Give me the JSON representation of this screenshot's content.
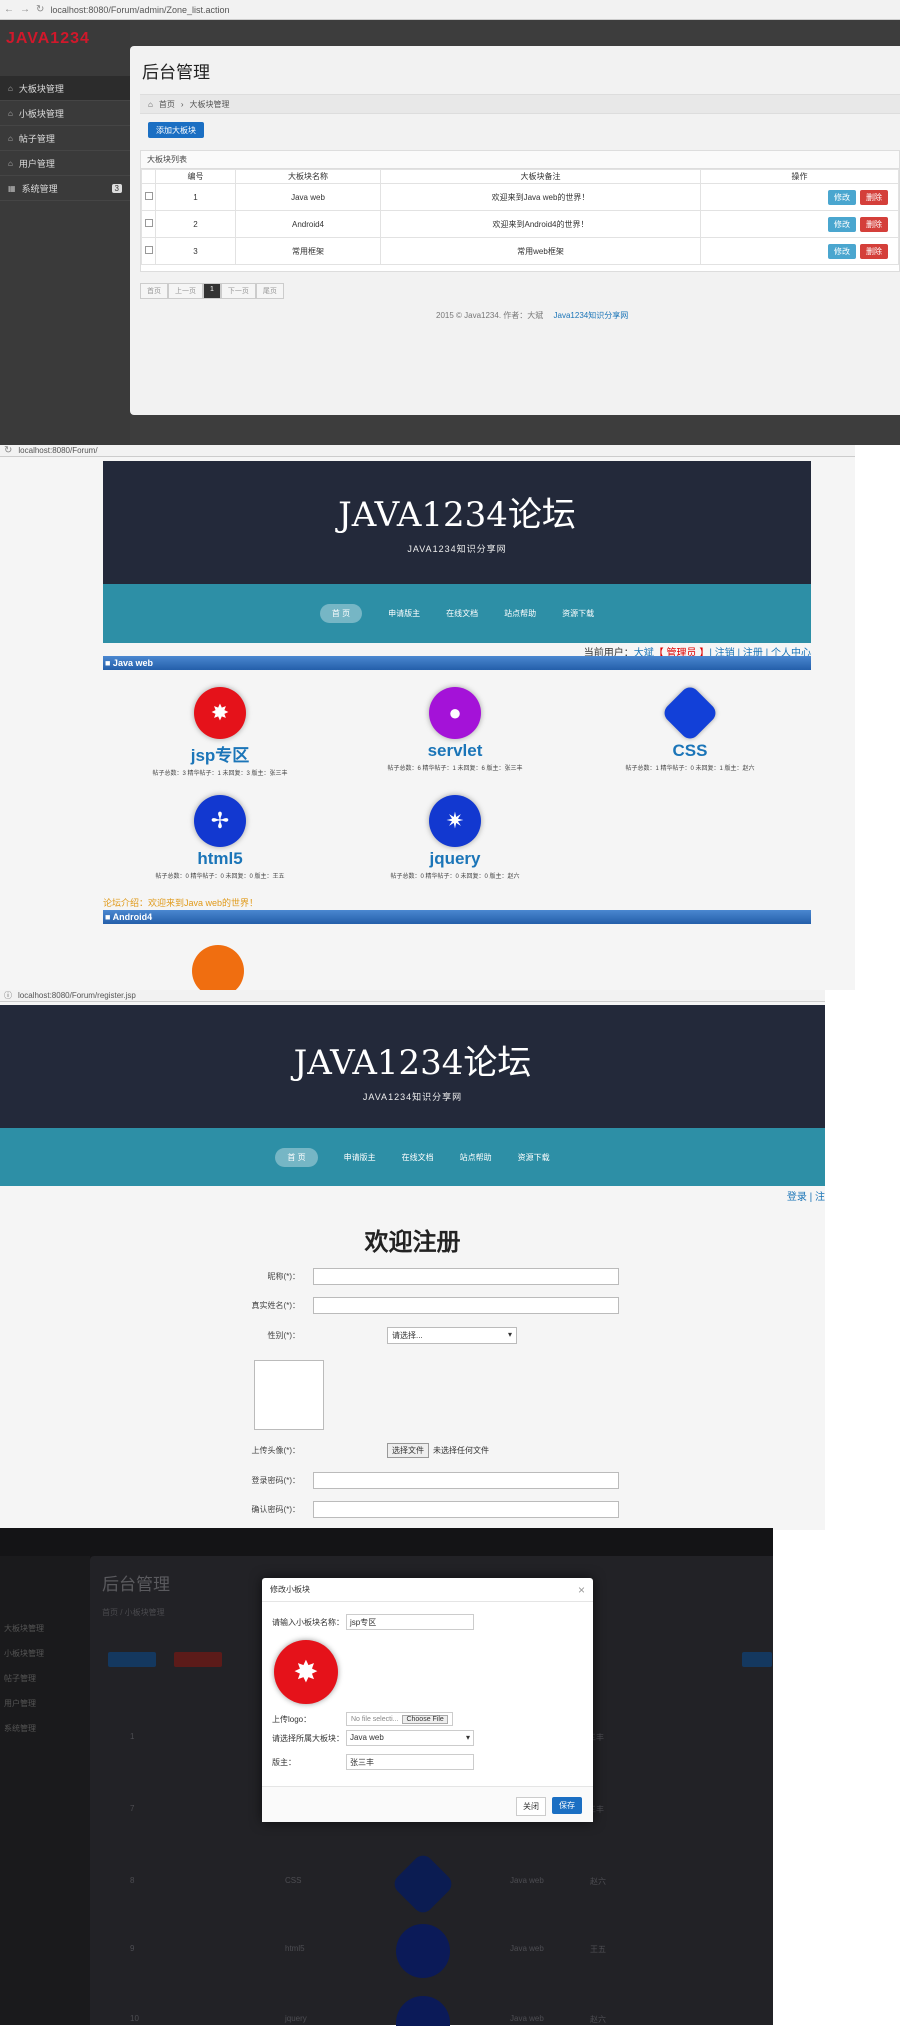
{
  "panel1": {
    "url": "localhost:8080/Forum/admin/Zone_list.action",
    "logo": "JAVA1234",
    "menu": [
      {
        "label": "大板块管理",
        "badge": ""
      },
      {
        "label": "小板块管理",
        "badge": ""
      },
      {
        "label": "帖子管理",
        "badge": ""
      },
      {
        "label": "用户管理",
        "badge": ""
      },
      {
        "label": "系统管理",
        "badge": "3"
      }
    ],
    "page_title": "后台管理",
    "breadcrumb": {
      "home": "首页",
      "current": "大板块管理"
    },
    "add_button": "添加大板块",
    "table_caption": "大板块列表",
    "columns": [
      "",
      "编号",
      "大板块名称",
      "大板块备注",
      "操作"
    ],
    "rows": [
      {
        "id": "1",
        "name": "Java web",
        "remark": "欢迎来到Java web的世界！"
      },
      {
        "id": "2",
        "name": "Android4",
        "remark": "欢迎来到Android4的世界！"
      },
      {
        "id": "3",
        "name": "常用框架",
        "remark": "常用web框架"
      }
    ],
    "edit_label": "修改",
    "delete_label": "删除",
    "pager": [
      "首页",
      "上一页",
      "1",
      "下一页",
      "尾页"
    ],
    "footer_text": "2015 © Java1234. 作者：大斌",
    "footer_link": "Java1234知识分享网"
  },
  "panel2": {
    "url": "localhost:8080/Forum/",
    "brand": "JAVA1234论坛",
    "subtitle": "JAVA1234知识分享网",
    "nav": [
      "首 页",
      "申请版主",
      "在线文档",
      "站点帮助",
      "资源下载"
    ],
    "user_prefix": "当前用户：",
    "user_name": "大斌",
    "user_role": "【 管理员 】",
    "user_links": "| 注销 | 注册 | 个人中心",
    "section1": "■ Java web",
    "tiles": [
      {
        "name": "jsp专区",
        "stats": "帖子总数：3 精华帖子：1 未回复：3 版主：张三丰",
        "color": "#e5121a",
        "glyph": "✸"
      },
      {
        "name": "servlet",
        "stats": "帖子总数：6 精华帖子：1 未回复：6 版主：张三丰",
        "color": "#a412d8",
        "glyph": "●"
      },
      {
        "name": "CSS",
        "stats": "帖子总数：1 精华帖子：0 未回复：1 版主：赵六",
        "color": "#1240d8",
        "glyph": "◆"
      },
      {
        "name": "html5",
        "stats": "帖子总数：0 精华帖子：0 未回复：0 版主：王五",
        "color": "#1238d0",
        "glyph": "✢"
      },
      {
        "name": "jquery",
        "stats": "帖子总数：0 精华帖子：0 未回复：0 版主：赵六",
        "color": "#1238d0",
        "glyph": "✷"
      }
    ],
    "intro": "论坛介绍：欢迎来到Java web的世界！",
    "section2": "■ Android4"
  },
  "panel3": {
    "url": "localhost:8080/Forum/register.jsp",
    "brand": "JAVA1234论坛",
    "subtitle": "JAVA1234知识分享网",
    "nav": [
      "首 页",
      "申请版主",
      "在线文档",
      "站点帮助",
      "资源下载"
    ],
    "login_link": "登录 | 注",
    "heading": "欢迎注册",
    "fields": {
      "username": "昵称(*)：",
      "realname": "真实姓名(*)：",
      "gender": "性别(*)：",
      "avatar": "上传头像(*)：",
      "password": "登录密码(*)：",
      "confirm": "确认密码(*)："
    },
    "gender_select": "请选择...",
    "file_button": "选择文件",
    "file_status": "未选择任何文件"
  },
  "panel4": {
    "bg_title": "后台管理",
    "bg_crumb": "首页 / 小板块管理",
    "modal_title": "修改小板块",
    "close_x": "×",
    "name_label": "请输入小板块名称：",
    "name_value": "jsp专区",
    "logo_label": "上传logo：",
    "file_placeholder": "No file selecti...",
    "file_button": "Choose File",
    "zone_label": "请选择所属大板块：",
    "zone_value": "Java web",
    "master_label": "版主：",
    "master_value": "张三丰",
    "close_button": "关闭",
    "save_button": "保存",
    "bg_rows": [
      {
        "id": "1",
        "name": "",
        "zone": "",
        "master": "张三丰"
      },
      {
        "id": "7",
        "name": "",
        "zone": "",
        "master": "张三丰"
      },
      {
        "id": "8",
        "name": "CSS",
        "zone": "Java web",
        "master": "赵六"
      },
      {
        "id": "9",
        "name": "html5",
        "zone": "Java web",
        "master": "王五"
      },
      {
        "id": "10",
        "name": "jquery",
        "zone": "Java web",
        "master": "赵六"
      }
    ],
    "bg_side": [
      "大板块管理",
      "小板块管理",
      "帖子管理",
      "用户管理",
      "系统管理"
    ]
  }
}
